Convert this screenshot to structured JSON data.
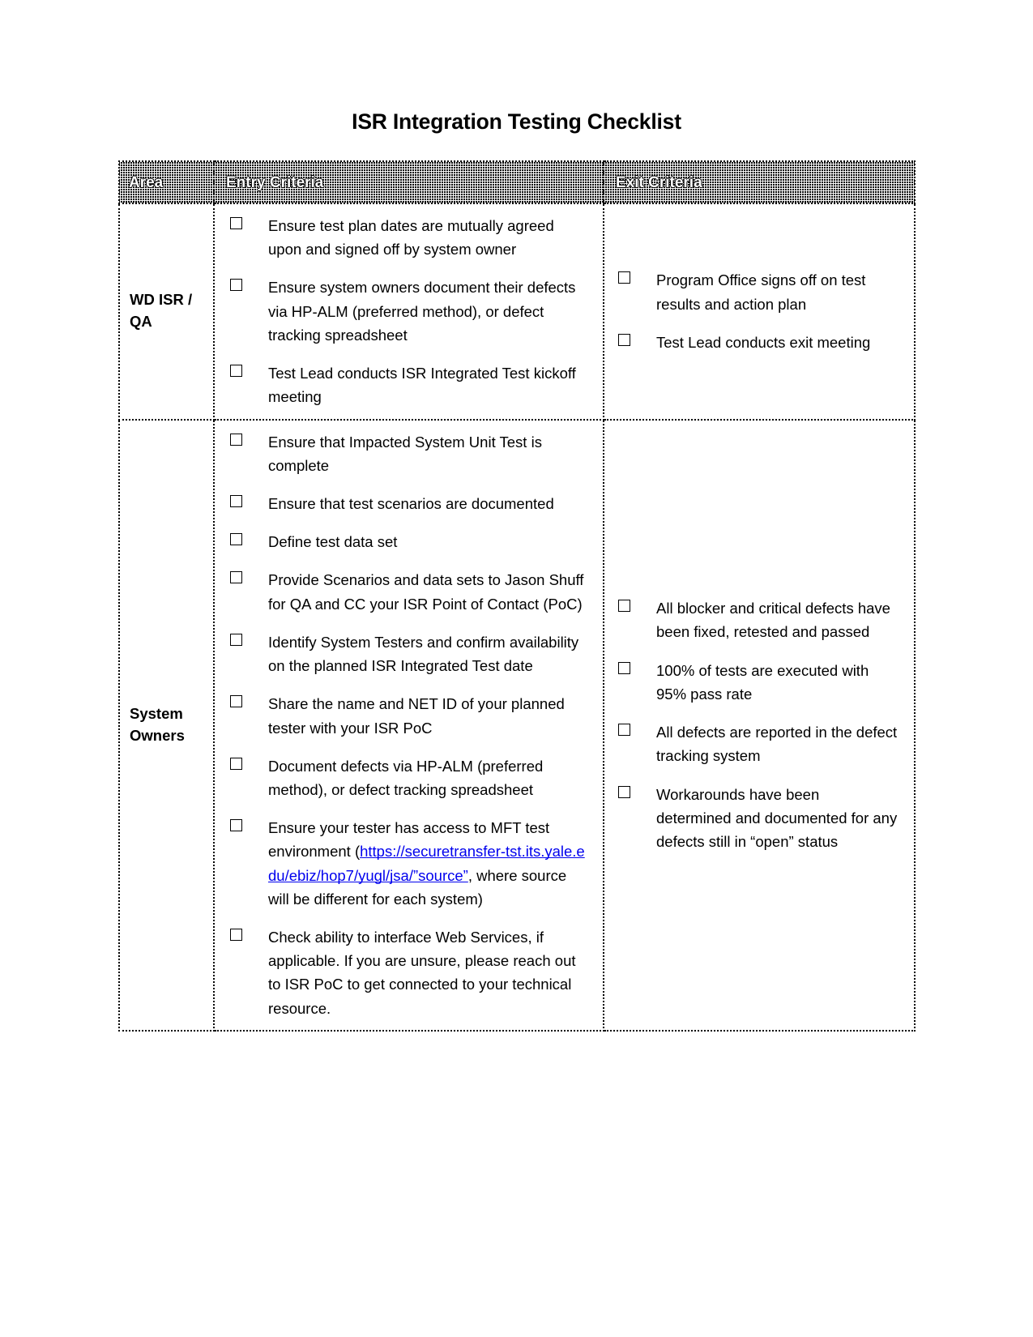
{
  "document": {
    "title": "ISR Integration Testing Checklist"
  },
  "table": {
    "headers": {
      "area": "Area",
      "entry": "Entry Criteria",
      "exit": "Exit Criteria"
    },
    "rows": [
      {
        "area": "WD ISR / QA",
        "area_line1": "WD ISR /",
        "area_line2": "QA",
        "entry_criteria": [
          "Ensure test plan dates are mutually agreed upon and signed off by system owner",
          "Ensure system owners document their defects via HP-ALM (preferred method), or defect tracking spreadsheet",
          "Test Lead conducts ISR Integrated Test kickoff meeting"
        ],
        "exit_criteria": [
          "Program Office signs off on test results and action plan",
          "Test Lead conducts exit meeting"
        ]
      },
      {
        "area": "System Owners",
        "area_line1": "System",
        "area_line2": "Owners",
        "entry_criteria": [
          "Ensure that Impacted System Unit Test is complete",
          "Ensure that test scenarios are documented",
          "Define test data set",
          "Provide Scenarios and data sets to Jason Shuff for QA  and CC your ISR Point of Contact (PoC)",
          "Identify System Testers and confirm availability on the planned ISR Integrated Test date",
          "Share the name and NET ID of your planned tester with your ISR PoC",
          "Document defects via HP-ALM (preferred method), or defect tracking spreadsheet",
          "Check ability to interface Web Services, if applicable. If you are unsure, please reach out to ISR PoC to get connected to your technical resource."
        ],
        "entry_link_item": {
          "prefix": "Ensure your tester has access to MFT test environment (",
          "link": "https://securetransfer-tst.its.yale.edu/ebiz/hop7/yugl/jsa/”source”",
          "suffix": ", where source will be different for each system)"
        },
        "exit_criteria": [
          "All blocker and critical defects have been fixed, retested and passed",
          "100% of tests are executed with 95% pass rate",
          "All defects are reported in the defect tracking system",
          "Workarounds have been determined and documented for any defects still in “open” status"
        ]
      }
    ]
  },
  "icons": {
    "checkbox": "empty-checkbox"
  },
  "colors": {
    "header_background": "#0b0b0b",
    "header_text": "#ffffff",
    "body_text": "#000000",
    "page_background": "#ffffff",
    "border": "#000000"
  }
}
